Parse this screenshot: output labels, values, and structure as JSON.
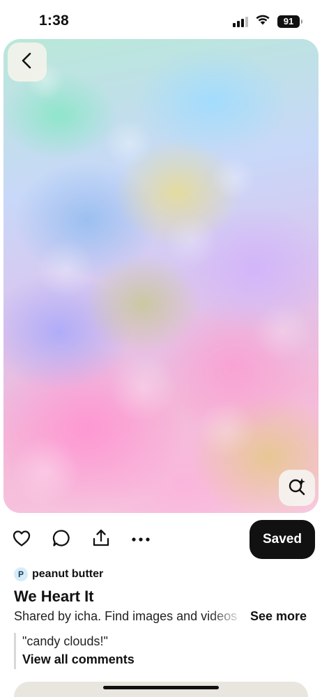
{
  "status_bar": {
    "time": "1:38",
    "battery": "91",
    "icons": [
      "cellular-signal-icon",
      "wifi-icon",
      "battery-icon"
    ]
  },
  "image": {
    "icons": [
      "back-chevron-icon",
      "visual-search-icon"
    ]
  },
  "actions": {
    "icons": [
      "heart-icon",
      "comment-icon",
      "share-icon",
      "more-icon"
    ],
    "saved_label": "Saved"
  },
  "creator": {
    "avatar_initial": "P",
    "name": "peanut butter"
  },
  "pin": {
    "title": "We Heart It",
    "description": "Shared by icha. Find images and videos",
    "see_more": "See more"
  },
  "comments": {
    "preview": "\"candy clouds!\"",
    "view_all": "View all comments"
  },
  "colors": {
    "primary_button": "#111111",
    "overlay_button": "#f5f3eb",
    "card": "#e8e6de"
  }
}
